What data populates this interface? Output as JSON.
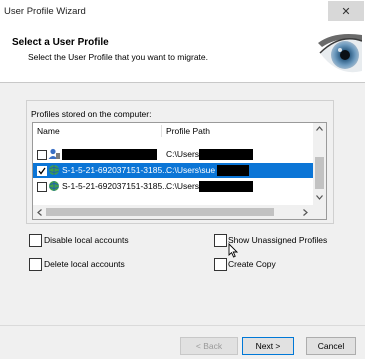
{
  "window": {
    "title": "User Profile Wizard",
    "close_glyph": "✕"
  },
  "header": {
    "heading": "Select a User Profile",
    "subheading": "Select the User Profile that you want to migrate."
  },
  "profiles": {
    "group_label": "Profiles stored on the computer:",
    "columns": {
      "name": "Name",
      "path": "Profile Path"
    },
    "rows": [
      {
        "name": "",
        "path": "C:\\Users\\",
        "checked": false,
        "selected": false,
        "icon": "user-icon"
      },
      {
        "name": "S-1-5-21-692037151-3185...",
        "path": "C:\\Users\\sue",
        "checked": true,
        "selected": true,
        "icon": "globe-user-icon"
      },
      {
        "name": "S-1-5-21-692037151-3185...",
        "path": "C:\\Users\\",
        "checked": false,
        "selected": false,
        "icon": "globe-user-icon"
      }
    ]
  },
  "options": {
    "disable_local": "Disable local accounts",
    "delete_local": "Delete local accounts",
    "show_unassigned": "Show Unassigned Profiles",
    "create_copy": "Create Copy"
  },
  "buttons": {
    "back": "< Back",
    "next": "Next >",
    "cancel": "Cancel"
  },
  "colors": {
    "selection": "#0b75d6",
    "window_bg": "#f0f0f0"
  }
}
